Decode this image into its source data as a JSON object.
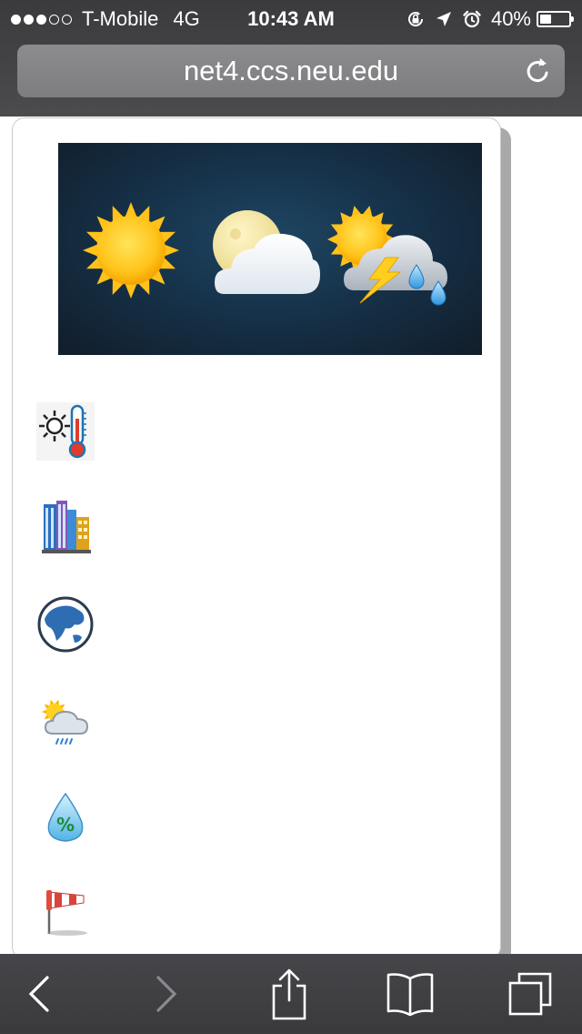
{
  "status_bar": {
    "carrier": "T-Mobile",
    "network": "4G",
    "time": "10:43 AM",
    "battery_percent": "40%",
    "signal_bars": 3,
    "signal_total": 5,
    "battery_level": 0.4
  },
  "browser": {
    "url": "net4.ccs.neu.edu",
    "back_enabled": true,
    "forward_enabled": false
  },
  "page": {
    "banner_icons": [
      "sun-icon",
      "moon-cloud-icon",
      "sun-storm-rain-icon"
    ],
    "nav_icons": [
      "thermometer-sun-icon",
      "city-buildings-icon",
      "globe-icon",
      "sun-rain-cloud-icon",
      "humidity-drop-icon",
      "windsock-icon"
    ],
    "humidity_symbol": "%"
  },
  "colors": {
    "chrome_dark": "#3b3b3d",
    "url_field": "#8c8c8e",
    "banner_bg": "#16324a"
  }
}
